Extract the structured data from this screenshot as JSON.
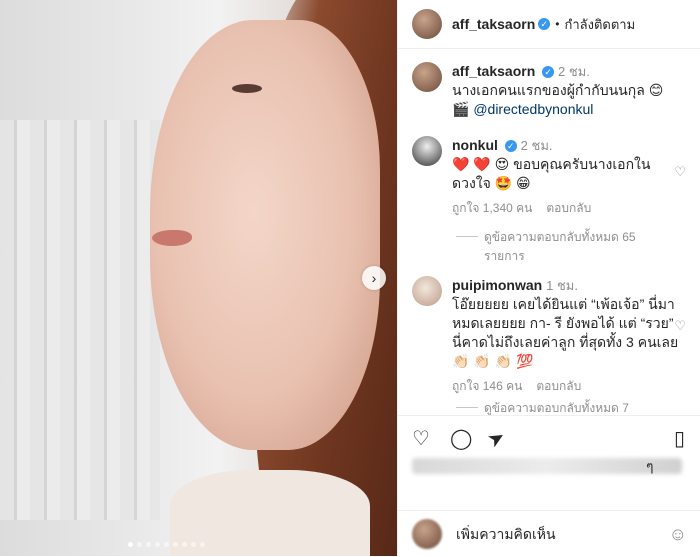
{
  "post": {
    "author": "aff_taksaorn",
    "follow_status": "กำลังติดตาม",
    "separator": "•",
    "carousel": {
      "current": 1,
      "total": 9
    }
  },
  "caption": {
    "author": "aff_taksaorn",
    "time": "2 ชม.",
    "text": "นางเอกคนแรกของผู้กำกับนนกุล 😊",
    "credit_icon": "🎬",
    "credit": "@directedbynonkul"
  },
  "comments": [
    {
      "author": "nonkul",
      "time": "2 ชม.",
      "text": "❤️ ❤️ 😍 ขอบคุณครับนางเอกในดวงใจ 🤩 😁",
      "likes": "ถูกใจ 1,340 คน",
      "reply_label": "ตอบกลับ",
      "view_replies": "ดูข้อความตอบกลับทั้งหมด 65 รายการ"
    },
    {
      "author": "puipimonwan",
      "time": "1 ชม.",
      "text": "โอ๊ยยยยย เคยได้ยินแต่ “เพ้อเจ้อ” นี่มาหมดเลยยยย กา- รี ยังพอได้ แต่ “รวย” นี่คาดไม่ถึงเลยค่าลูก ที่สุดทั้ง 3 คนเลย 👏🏻 👏🏻 👏🏻 💯",
      "likes": "ถูกใจ 146 คน",
      "reply_label": "ตอบกลับ",
      "view_replies": "ดูข้อความตอบกลับทั้งหมด 7"
    }
  ],
  "likes_suffix": "ๆ",
  "add_comment": {
    "placeholder": "เพิ่มความคิดเห็น",
    "emoji": "☺"
  },
  "icons": {
    "heart": "♡",
    "comment": "◯",
    "share": "➤",
    "save": "▯",
    "next": "›",
    "verified": "✓",
    "more": "⋯"
  }
}
